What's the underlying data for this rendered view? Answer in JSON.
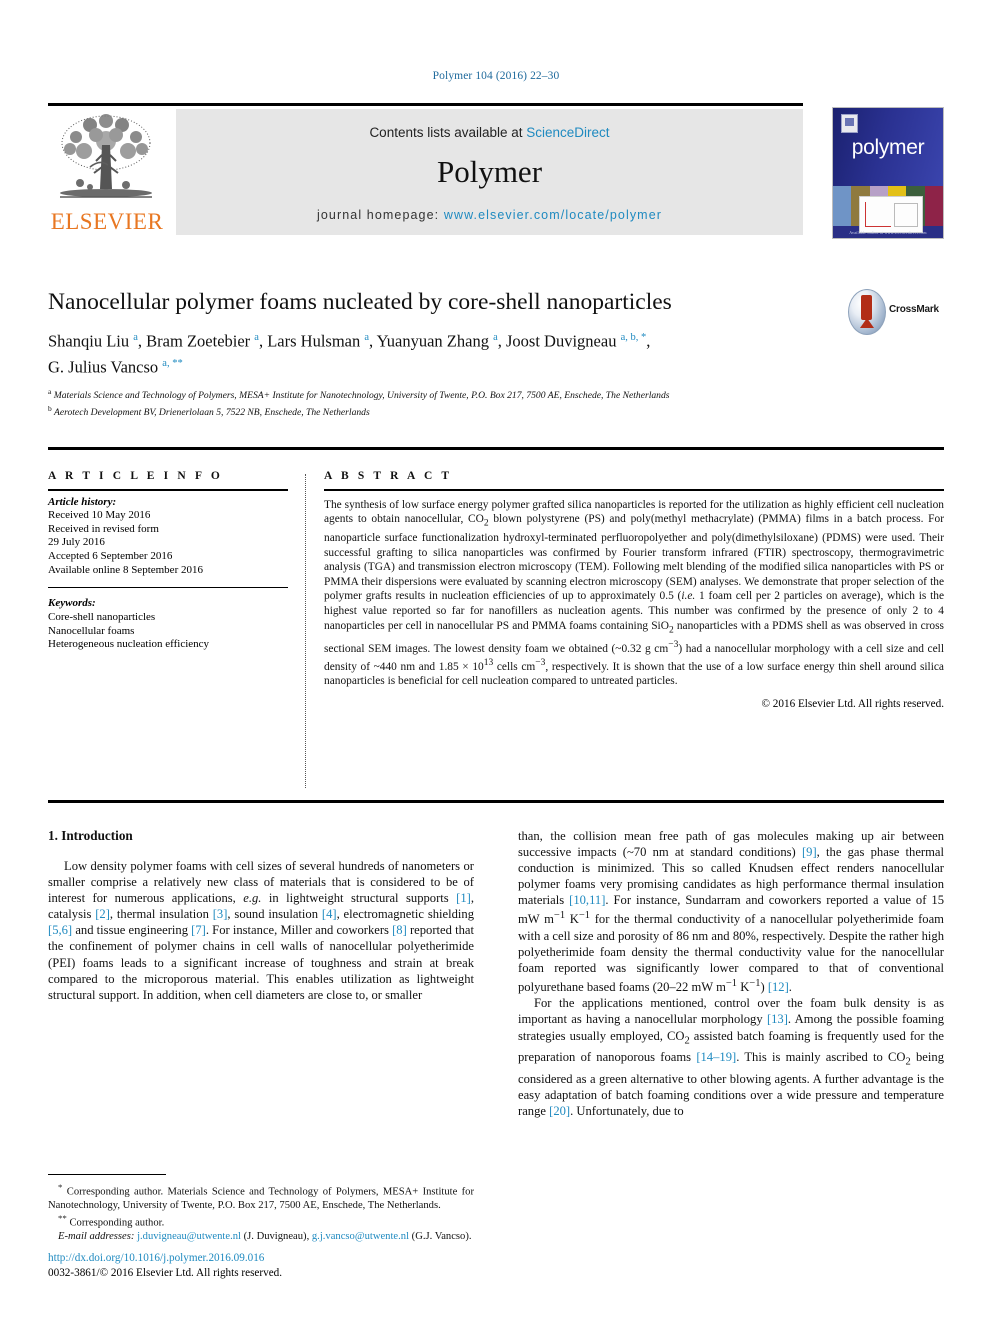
{
  "running_head": "Polymer 104 (2016) 22–30",
  "masthead": {
    "contents_prefix": "Contents lists available at ",
    "sciencedirect": "ScienceDirect",
    "journal_title": "Polymer",
    "homepage_label": "journal homepage: ",
    "homepage_url": "www.elsevier.com/locate/polymer",
    "publisher": "ELSEVIER",
    "cover_word": "polymer",
    "cover_footer": "Available online at www.sciencedirect.com"
  },
  "article": {
    "title": "Nanocellular polymer foams nucleated by core-shell nanoparticles",
    "crossmark_label": "CrossMark",
    "authors_line1": "Shanqiu Liu <sup>a</sup>, Bram Zoetebier <sup>a</sup>, Lars Hulsman <sup>a</sup>, Yuanyuan Zhang <sup>a</sup>, Joost Duvigneau <sup>a, b, *</sup>,",
    "authors_line2": "G. Julius Vancso <sup>a, **</sup>",
    "affiliation_a": "<sup>a</sup> Materials Science and Technology of Polymers, MESA+ Institute for Nanotechnology, University of Twente, P.O. Box 217, 7500 AE, Enschede, The Netherlands",
    "affiliation_b": "<sup>b</sup> Aerotech Development BV, Drienerlolaan 5, 7522 NB, Enschede, The Netherlands"
  },
  "article_info": {
    "heading": "A R T I C L E  I N F O",
    "history_label": "Article history:",
    "history": [
      "Received 10 May 2016",
      "Received in revised form",
      "29 July 2016",
      "Accepted 6 September 2016",
      "Available online 8 September 2016"
    ],
    "keywords_label": "Keywords:",
    "keywords": [
      "Core-shell nanoparticles",
      "Nanocellular foams",
      "Heterogeneous nucleation efficiency"
    ]
  },
  "abstract": {
    "heading": "A B S T R A C T",
    "text": "The synthesis of low surface energy polymer grafted silica nanoparticles is reported for the utilization as highly efficient cell nucleation agents to obtain nanocellular, CO<sub>2</sub> blown polystyrene (PS) and poly(methyl methacrylate) (PMMA) films in a batch process. For nanoparticle surface functionalization hydroxyl-terminated perfluoropolyether and poly(dimethylsiloxane) (PDMS) were used. Their successful grafting to silica nanoparticles was confirmed by Fourier transform infrared (FTIR) spectroscopy, thermogravimetric analysis (TGA) and transmission electron microscopy (TEM). Following melt blending of the modified silica nanoparticles with PS or PMMA their dispersions were evaluated by scanning electron microscopy (SEM) analyses. We demonstrate that proper selection of the polymer grafts results in nucleation efficiencies of up to approximately 0.5 (<i>i.e.</i> 1 foam cell per 2 particles on average), which is the highest value reported so far for nanofillers as nucleation agents. This number was confirmed by the presence of only 2 to 4 nanoparticles per cell in nanocellular PS and PMMA foams containing SiO<sub>2</sub> nanoparticles with a PDMS shell as was observed in cross sectional SEM images. The lowest density foam we obtained (~0.32 g cm<sup>−3</sup>) had a nanocellular morphology with a cell size and cell density of ~440 nm and 1.85 × 10<sup>13</sup> cells cm<sup>−3</sup>, respectively. It is shown that the use of a low surface energy thin shell around silica nanoparticles is beneficial for cell nucleation compared to untreated particles.",
    "copyright": "© 2016 Elsevier Ltd. All rights reserved."
  },
  "body": {
    "section_heading": "1. Introduction",
    "left_p1": "Low density polymer foams with cell sizes of several hundreds of nanometers or smaller comprise a relatively new class of materials that is considered to be of interest for numerous applications, <i>e.g.</i> in lightweight structural supports <span class=\"ref\">[1]</span>, catalysis <span class=\"ref\">[2]</span>, thermal insulation <span class=\"ref\">[3]</span>, sound insulation <span class=\"ref\">[4]</span>, electromagnetic shielding <span class=\"ref\">[5,6]</span> and tissue engineering <span class=\"ref\">[7]</span>. For instance, Miller and coworkers <span class=\"ref\">[8]</span> reported that the confinement of polymer chains in cell walls of nanocellular polyetherimide (PEI) foams leads to a significant increase of toughness and strain at break compared to the microporous material. This enables utilization as lightweight structural support. In addition, when cell diameters are close to, or smaller",
    "right_p1": "than, the collision mean free path of gas molecules making up air between successive impacts (~70 nm at standard conditions) <span class=\"ref\">[9]</span>, the gas phase thermal conduction is minimized. This so called Knudsen effect renders nanocellular polymer foams very promising candidates as high performance thermal insulation materials <span class=\"ref\">[10,11]</span>. For instance, Sundarram and coworkers reported a value of 15 mW m<sup>−1</sup> K<sup>−1</sup> for the thermal conductivity of a nanocellular polyetherimide foam with a cell size and porosity of 86 nm and 80%, respectively. Despite the rather high polyetherimide foam density the thermal conductivity value for the nanocellular foam reported was significantly lower compared to that of conventional polyurethane based foams (20–22 mW m<sup>−1</sup> K<sup>−1</sup>) <span class=\"ref\">[12]</span>.",
    "right_p2": "For the applications mentioned, control over the foam bulk density is as important as having a nanocellular morphology <span class=\"ref\">[13]</span>. Among the possible foaming strategies usually employed, CO<sub>2</sub> assisted batch foaming is frequently used for the preparation of nanoporous foams <span class=\"ref\">[14–19]</span>. This is mainly ascribed to CO<sub>2</sub> being considered as a green alternative to other blowing agents. A further advantage is the easy adaptation of batch foaming conditions over a wide pressure and temperature range <span class=\"ref\">[20]</span>. Unfortunately, due to"
  },
  "footnotes": {
    "note1": "<sup>*</sup> Corresponding author. Materials Science and Technology of Polymers, MESA+ Institute for Nanotechnology, University of Twente, P.O. Box 217, 7500 AE, Enschede, The Netherlands.",
    "note2": "<sup>**</sup> Corresponding author.",
    "emails": "<i>E-mail addresses:</i> <span class=\"link\">j.duvigneau@utwente.nl</span> (J. Duvigneau), <span class=\"link\">g.j.vancso@utwente.nl</span> (G.J. Vancso).",
    "doi": "http://dx.doi.org/10.1016/j.polymer.2016.09.016",
    "issn_copyright": "0032-3861/© 2016 Elsevier Ltd. All rights reserved."
  },
  "colors": {
    "link": "#1f8ac0",
    "elsevier_orange": "#e87722",
    "cover_blue": "#2a3191"
  }
}
